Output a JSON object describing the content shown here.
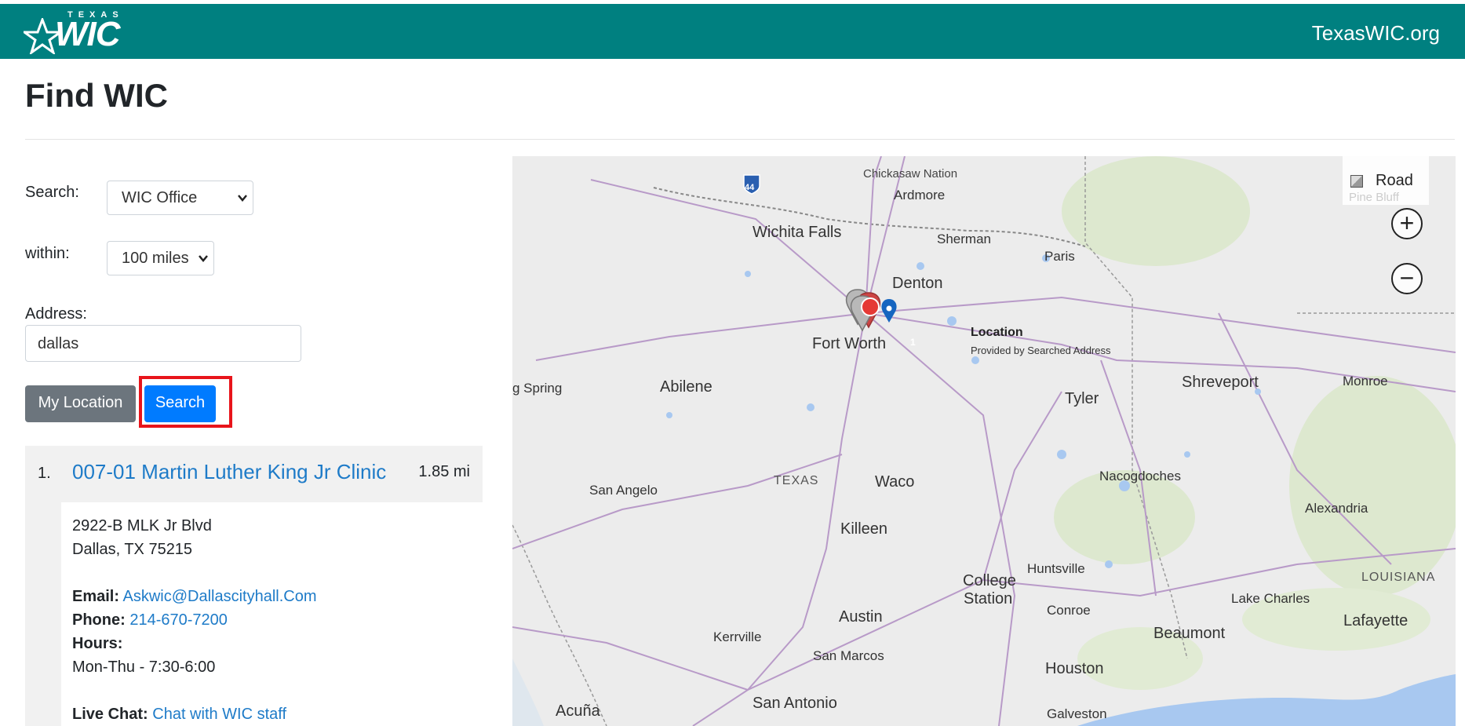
{
  "header": {
    "logo_top": "TEXAS",
    "logo_main": "WIC",
    "site_link": "TexasWIC.org",
    "bar_color": "#008080"
  },
  "page": {
    "title": "Find WIC"
  },
  "form": {
    "search_label": "Search:",
    "search_value": "WIC Office",
    "within_label": "within:",
    "within_value": "100 miles",
    "address_label": "Address:",
    "address_value": "dallas",
    "my_location_label": "My Location",
    "search_button_label": "Search"
  },
  "results": [
    {
      "number": "1.",
      "name": "007-01 Martin Luther King Jr Clinic",
      "distance": "1.85 mi",
      "address_line1": "2922-B MLK Jr Blvd",
      "address_line2": "Dallas, TX 75215",
      "email_label": "Email:",
      "email": "Askwic@Dallascityhall.Com",
      "phone_label": "Phone:",
      "phone": "214-670-7200",
      "hours_label": "Hours:",
      "hours": "Mon-Thu - 7:30-6:00",
      "chat_label": "Live Chat:",
      "chat_link": "Chat with WIC staff"
    }
  ],
  "map": {
    "style_label": "Road",
    "zoom_in": "+",
    "zoom_out": "−",
    "marker_count": "1",
    "location_label": "Location",
    "location_sub": "Provided by Searched Address",
    "labels": {
      "chickasaw": "Chickasaw Nation",
      "ardmore": "Ardmore",
      "wichita_falls": "Wichita Falls",
      "sherman": "Sherman",
      "paris": "Paris",
      "denton": "Denton",
      "fort_worth": "Fort Worth",
      "big_spring": "g Spring",
      "abilene": "Abilene",
      "shreveport": "Shreveport",
      "monroe": "Monroe",
      "tyler": "Tyler",
      "texas": "TEXAS",
      "waco": "Waco",
      "nacogdoches": "Nacogdoches",
      "san_angelo": "San Angelo",
      "alexandria": "Alexandria",
      "killeen": "Killeen",
      "huntsville": "Huntsville",
      "louisiana": "LOUISIANA",
      "college": "College",
      "station": "Station",
      "lake_charles": "Lake Charles",
      "conroe": "Conroe",
      "lafayette": "Lafayette",
      "austin": "Austin",
      "kerrville": "Kerrville",
      "beaumont": "Beaumont",
      "san_marcos": "San Marcos",
      "houston": "Houston",
      "san_antonio": "San Antonio",
      "acuna": "Acuña",
      "galveston": "Galveston",
      "pine_bluff": "Pine Bluff",
      "i44": "44"
    },
    "colors": {
      "water": "#a8c8f0",
      "road": "#b89ac8",
      "green": "#d8e6c8"
    }
  }
}
